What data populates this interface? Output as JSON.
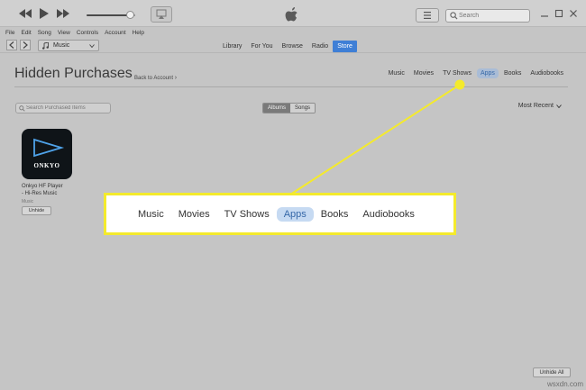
{
  "menu": [
    "File",
    "Edit",
    "Song",
    "View",
    "Controls",
    "Account",
    "Help"
  ],
  "toolbar": {
    "search_placeholder": "Search"
  },
  "nav": {
    "media_type": "Music",
    "tabs": [
      "Library",
      "For You",
      "Browse",
      "Radio",
      "Store"
    ],
    "active_tab": "Store"
  },
  "page": {
    "title": "Hidden Purchases",
    "back_link": "Back to Account",
    "categories": [
      "Music",
      "Movies",
      "TV Shows",
      "Apps",
      "Books",
      "Audiobooks"
    ],
    "active_category": "Apps",
    "filter_placeholder": "Search Purchased Items",
    "view_toggle": [
      "Albums",
      "Songs"
    ],
    "active_view": "Albums",
    "sort": "Most Recent"
  },
  "items": [
    {
      "logo": "ONKYO",
      "name_line1": "Onkyo HF Player",
      "name_line2": "- Hi-Res Music",
      "kind": "Music",
      "action": "Unhide"
    }
  ],
  "unhide_all": "Unhide All",
  "callout": {
    "categories": [
      "Music",
      "Movies",
      "TV Shows",
      "Apps",
      "Books",
      "Audiobooks"
    ],
    "active": "Apps",
    "color": "#f4ea2c"
  },
  "watermark": "wsxdn.com"
}
